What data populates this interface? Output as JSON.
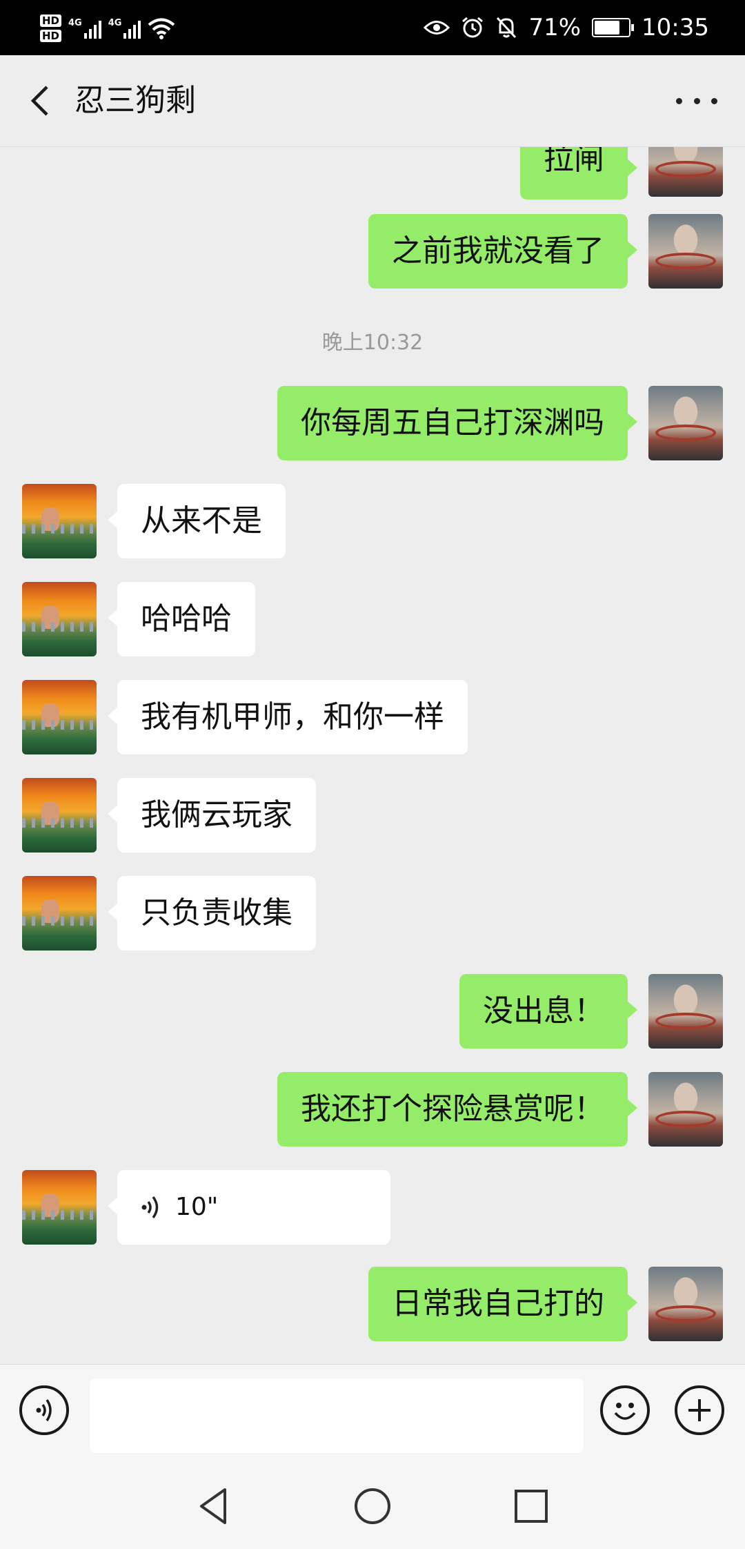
{
  "status_bar": {
    "hd1": "HD",
    "hd2": "HD",
    "net1": "4G",
    "net2": "4G",
    "battery_percent": "71%",
    "time": "10:35"
  },
  "header": {
    "title": "忍三狗剩",
    "back_icon": "chevron-left-icon",
    "more_icon": "more-dots-icon"
  },
  "messages": [
    {
      "side": "me",
      "text": "拉闸"
    },
    {
      "side": "me",
      "text": "之前我就没看了"
    },
    {
      "type": "time",
      "text": "晚上10:32"
    },
    {
      "side": "me",
      "text": "你每周五自己打深渊吗"
    },
    {
      "side": "friend",
      "text": "从来不是"
    },
    {
      "side": "friend",
      "text": "哈哈哈"
    },
    {
      "side": "friend",
      "text": "我有机甲师，和你一样"
    },
    {
      "side": "friend",
      "text": "我俩云玩家"
    },
    {
      "side": "friend",
      "text": "只负责收集"
    },
    {
      "side": "me",
      "text": "没出息！"
    },
    {
      "side": "me",
      "text": "我还打个探险悬赏呢！"
    },
    {
      "side": "friend",
      "type": "voice",
      "duration": "10\""
    },
    {
      "side": "me",
      "text": "日常我自己打的"
    }
  ],
  "input_bar": {
    "voice_icon": "voice-mode-icon",
    "emoji_icon": "emoji-icon",
    "plus_icon": "plus-icon"
  },
  "nav_bar": {
    "back_icon": "nav-back-icon",
    "home_icon": "nav-home-icon",
    "recents_icon": "nav-recents-icon"
  },
  "colors": {
    "my_bubble": "#95ec69",
    "friend_bubble": "#ffffff",
    "background": "#ededed"
  }
}
